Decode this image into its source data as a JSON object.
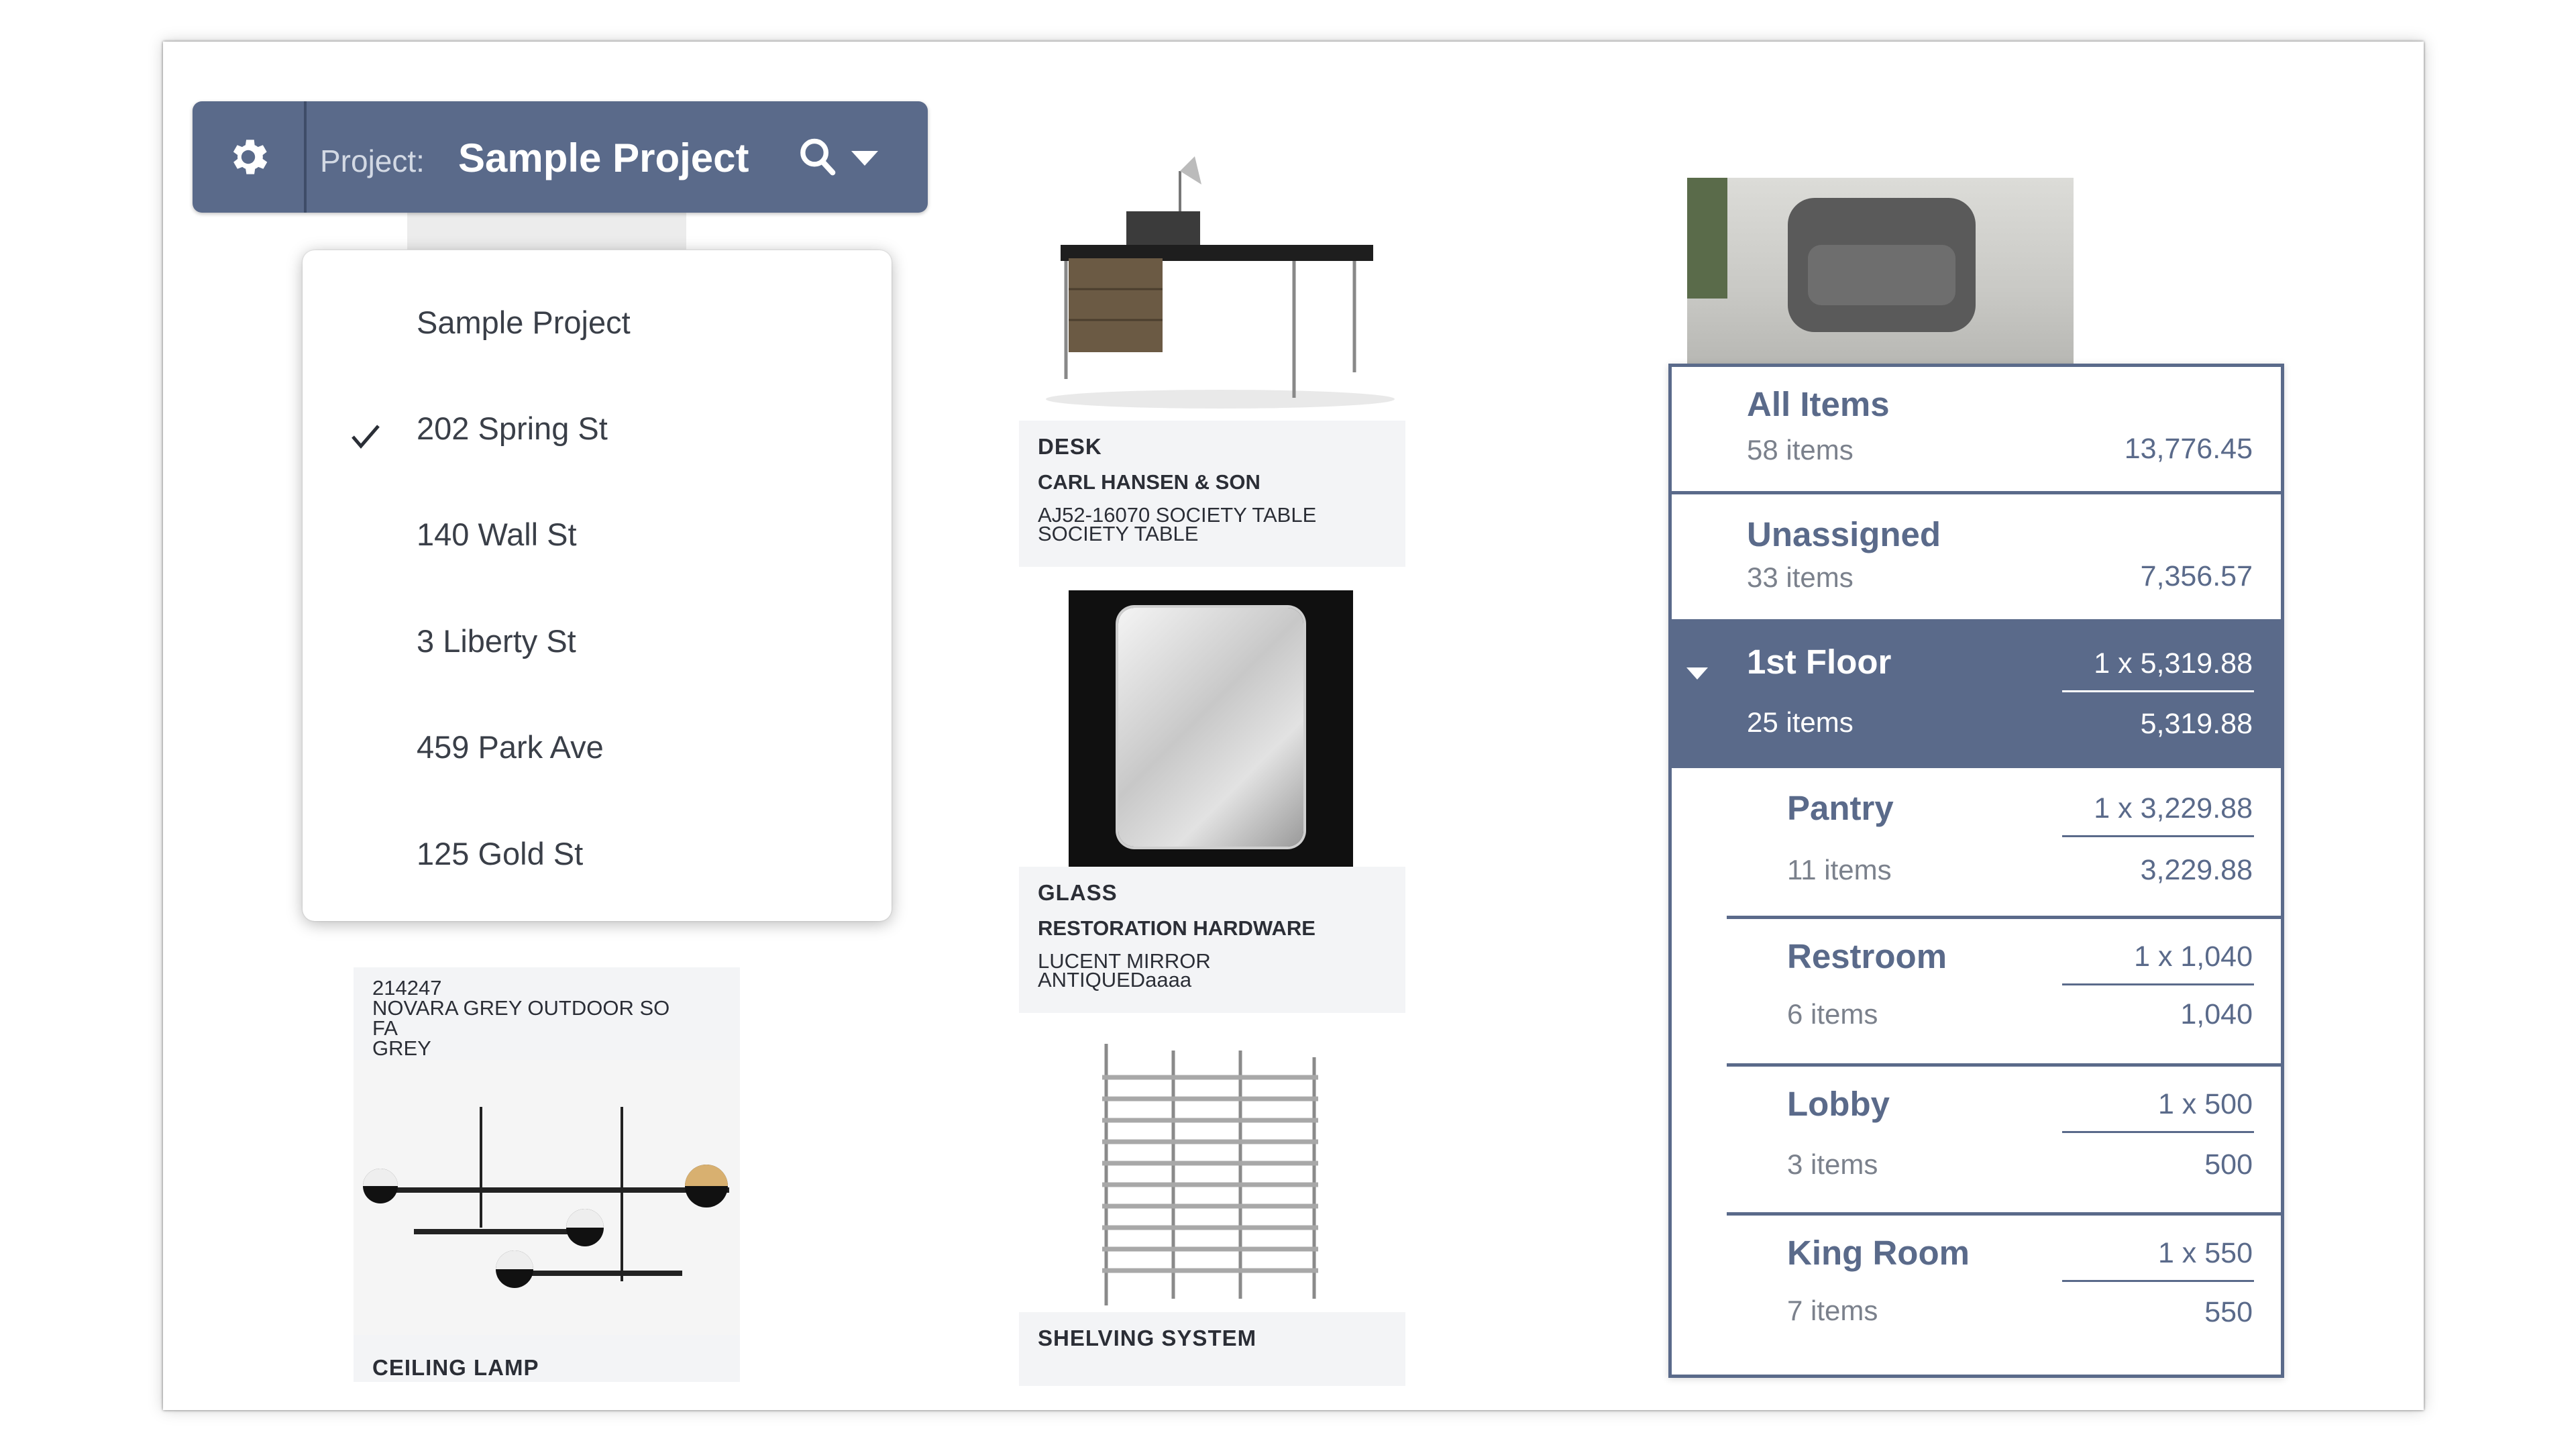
{
  "header": {
    "project_label": "Project:",
    "project_name": "Sample Project",
    "icons": [
      "gear-icon",
      "search-icon",
      "chevron-down-icon"
    ]
  },
  "dropdown": {
    "items": [
      {
        "label": "Sample Project",
        "checked": false
      },
      {
        "label": "202 Spring St",
        "checked": true
      },
      {
        "label": "140 Wall St",
        "checked": false
      },
      {
        "label": "3 Liberty St",
        "checked": false
      },
      {
        "label": "459 Park Ave",
        "checked": false
      },
      {
        "label": "125 Gold St",
        "checked": false
      }
    ]
  },
  "products": {
    "sofa": {
      "sku": "214247",
      "name_line1": "NOVARA GREY OUTDOOR SO",
      "name_line2": "FA",
      "finish": "GREY"
    },
    "lamp": {
      "category": "CEILING LAMP"
    },
    "desk": {
      "category": "DESK",
      "brand": "CARL HANSEN & SON",
      "name_line1": "AJ52-16070 SOCIETY TABLE",
      "name_line2": "SOCIETY TABLE"
    },
    "mirror": {
      "category": "GLASS",
      "brand": "RESTORATION HARDWARE",
      "name_line1": "LUCENT MIRROR",
      "name_line2": "ANTIQUEDaaaa"
    },
    "shelving": {
      "category": "SHELVING SYSTEM"
    }
  },
  "panel": {
    "all": {
      "title": "All Items",
      "count": "58 items",
      "total": "13,776.45"
    },
    "unassigned": {
      "title": "Unassigned",
      "count": "33 items",
      "total": "7,356.57"
    },
    "floor": {
      "title": "1st Floor",
      "count": "25 items",
      "qty": "1 x 5,319.88",
      "total": "5,319.88"
    },
    "rooms": [
      {
        "title": "Pantry",
        "count": "11 items",
        "qty": "1 x 3,229.88",
        "total": "3,229.88"
      },
      {
        "title": "Restroom",
        "count": "6 items",
        "qty": "1 x 1,040",
        "total": "1,040"
      },
      {
        "title": "Lobby",
        "count": "3 items",
        "qty": "1 x 500",
        "total": "500"
      },
      {
        "title": "King Room",
        "count": "7 items",
        "qty": "1 x 550",
        "total": "550"
      }
    ]
  },
  "colors": {
    "accent": "#5a6a8a",
    "text": "#3a3f48",
    "muted": "#7b818c"
  }
}
